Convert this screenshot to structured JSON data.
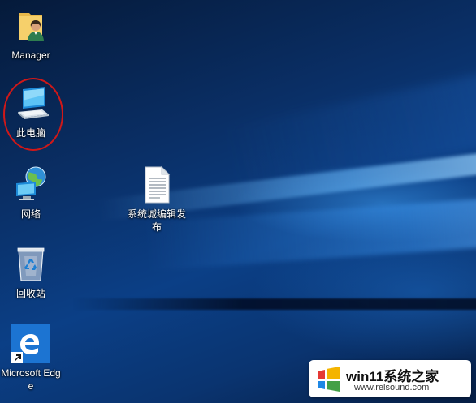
{
  "desktop": {
    "icons": [
      {
        "label": "Manager",
        "icon": "user-folder-icon"
      },
      {
        "label": "此电脑",
        "icon": "computer-icon"
      },
      {
        "label": "网络",
        "icon": "network-icon"
      },
      {
        "label": "回收站",
        "icon": "recycle-bin-icon"
      },
      {
        "label": "Microsoft Edge",
        "icon": "edge-shortcut-icon"
      },
      {
        "label": "系统城编辑发布",
        "icon": "text-document-icon"
      }
    ],
    "highlight_color": "#d01818",
    "accent": "#0b3f86"
  },
  "watermark": {
    "title": "win11系统之家",
    "url": "www.relsound.com"
  }
}
